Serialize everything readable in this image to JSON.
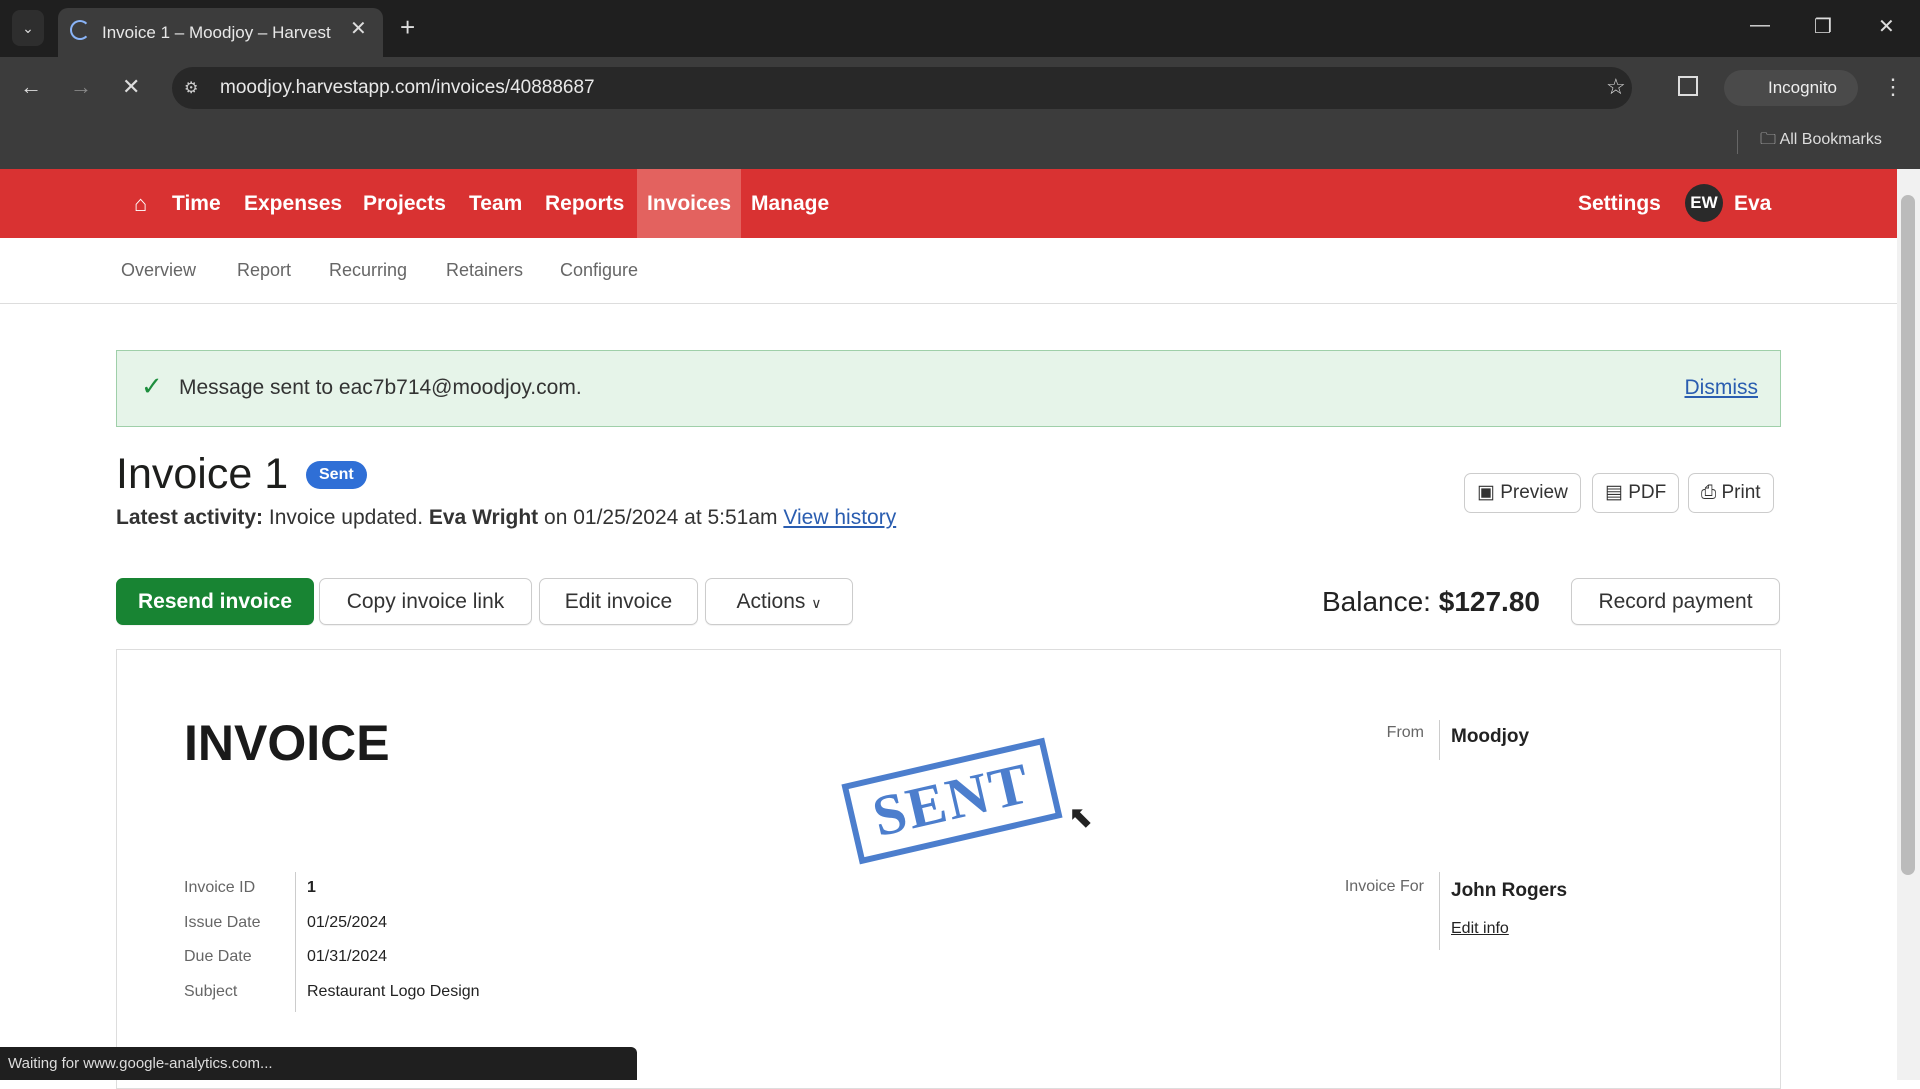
{
  "browser": {
    "tab_title": "Invoice 1 – Moodjoy – Harvest",
    "url": "moodjoy.harvestapp.com/invoices/40888687",
    "incognito_label": "Incognito",
    "bookmarks_label": "All Bookmarks",
    "status_text": "Waiting for www.google-analytics.com..."
  },
  "nav": {
    "items": [
      "Time",
      "Expenses",
      "Projects",
      "Team",
      "Reports",
      "Invoices",
      "Manage"
    ],
    "active": "Invoices",
    "settings": "Settings",
    "avatar_initials": "EW",
    "user": "Eva",
    "brand_color": "#d93232"
  },
  "subnav": {
    "items": [
      "Overview",
      "Report",
      "Recurring",
      "Retainers",
      "Configure"
    ]
  },
  "alert": {
    "message": "Message sent to eac7b714@moodjoy.com.",
    "dismiss": "Dismiss"
  },
  "invoice": {
    "title": "Invoice 1",
    "badge": "Sent",
    "activity": {
      "label": "Latest activity:",
      "text": "Invoice updated.",
      "user": "Eva Wright",
      "when": "on 01/25/2024 at 5:51am",
      "history_link": "View history"
    },
    "actions": {
      "resend": "Resend invoice",
      "copy_link": "Copy invoice link",
      "edit": "Edit invoice",
      "actions": "Actions",
      "preview": "Preview",
      "pdf": "PDF",
      "print": "Print",
      "record_payment": "Record payment"
    },
    "balance_label": "Balance:",
    "balance": "$127.80",
    "doc": {
      "heading": "INVOICE",
      "stamp": "SENT",
      "fields": [
        {
          "label": "Invoice ID",
          "value": "1"
        },
        {
          "label": "Issue Date",
          "value": "01/25/2024"
        },
        {
          "label": "Due Date",
          "value": "01/31/2024"
        },
        {
          "label": "Subject",
          "value": "Restaurant Logo Design"
        }
      ],
      "from_label": "From",
      "from": "Moodjoy",
      "for_label": "Invoice For",
      "for": "John Rogers",
      "edit_info": "Edit info"
    }
  }
}
